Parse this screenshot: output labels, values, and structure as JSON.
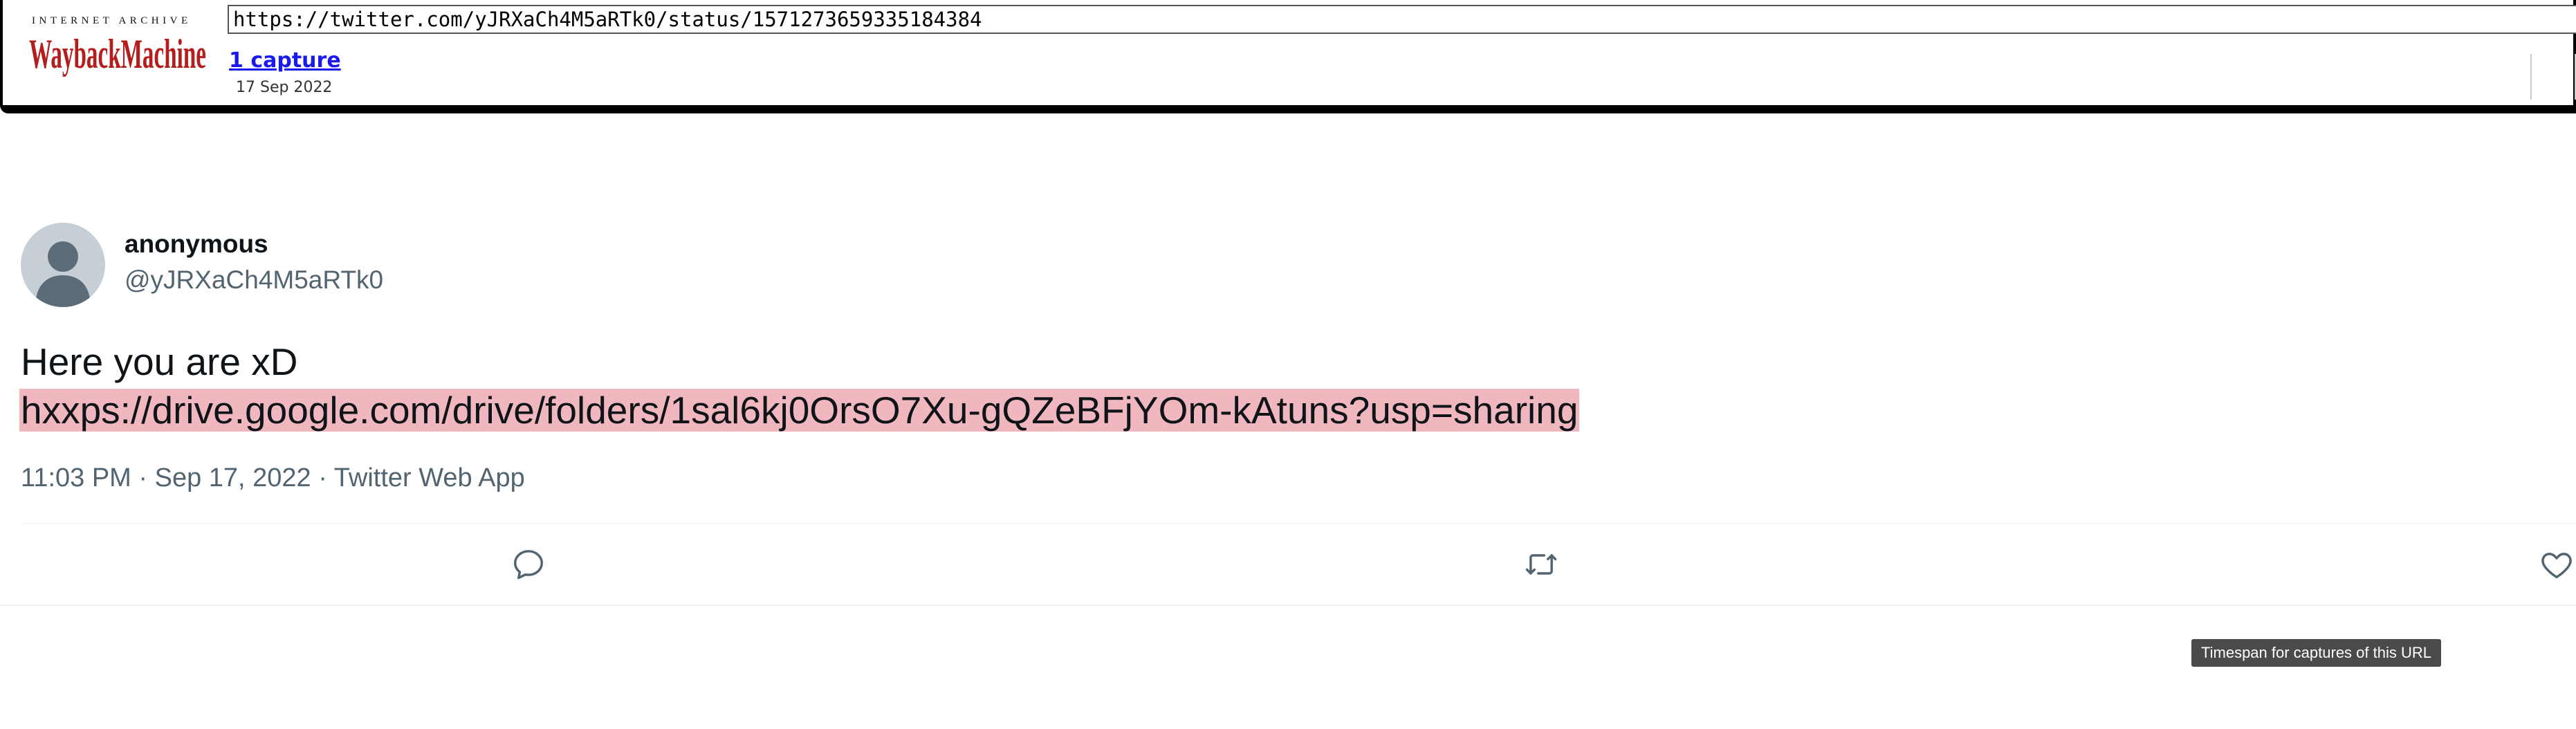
{
  "wayback": {
    "brand_top": "INTERNET ARCHIVE",
    "brand_main": "WaybackMachine",
    "url_value": "https://twitter.com/yJRXaCh4M5aRTk0/status/1571273659335184384",
    "captures_link": "1 capture",
    "capture_date": "17 Sep 2022",
    "tooltip": "Timespan for captures of this URL"
  },
  "tweet": {
    "author_name": "anonymous",
    "author_handle": "@yJRXaCh4M5aRTk0",
    "text_line1": "Here you are xD",
    "link_text": "hxxps://drive.google.com/drive/folders/1sal6kj0OrsO7Xu-gQZeBFjYOm-kAtuns?usp=sharing",
    "meta": "11:03 PM · Sep 17, 2022 · Twitter Web App"
  },
  "colors": {
    "wayback_red": "#b51d1d",
    "link_blue": "#1a1aee",
    "link_highlight": "#f0b8be",
    "muted_text": "#536471",
    "avatar_bg": "#c6ced6"
  },
  "icons": {
    "reply": "reply-icon",
    "retweet": "retweet-icon",
    "like": "like-icon"
  }
}
